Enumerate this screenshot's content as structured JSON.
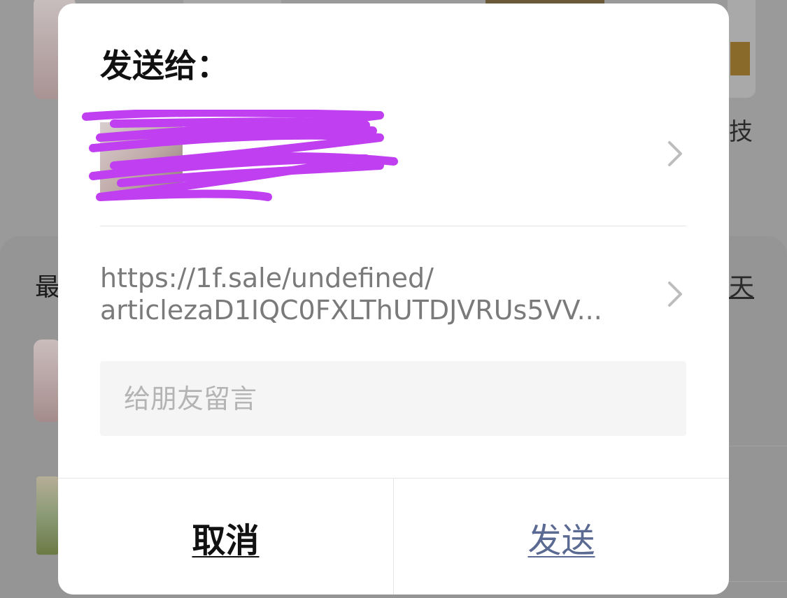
{
  "dialog": {
    "title": "发送给：",
    "recipient": {
      "name": "",
      "redacted": true,
      "scribble_color": "#c03ff0"
    },
    "link": {
      "line1": "https://1f.sale/undefined/",
      "line2": "articlezaD1IQC0FXLThUTDJVRUs5VV..."
    },
    "message_placeholder": "给朋友留言",
    "cancel_label": "取消",
    "send_label": "发送",
    "send_color": "#5b6a92"
  },
  "background": {
    "left_text": "最",
    "right_text_1": "技",
    "right_text_2": "天"
  },
  "icons": {
    "chevron": "chevron-right-icon"
  }
}
